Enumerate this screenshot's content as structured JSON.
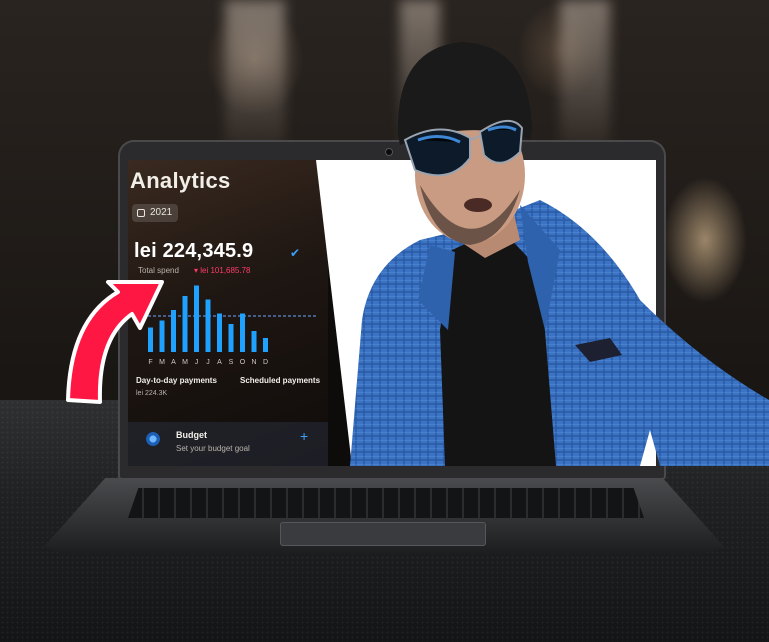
{
  "app": {
    "title": "Analytics",
    "year": "2021",
    "amount": "lei 224,345.9",
    "spend_label": "Total spend",
    "spend_change": "▾ lei 101,685.78",
    "months": [
      "F",
      "M",
      "A",
      "M",
      "J",
      "J",
      "A",
      "S",
      "O",
      "N",
      "D"
    ],
    "bar_levels": [
      0.35,
      0.45,
      0.6,
      0.8,
      0.95,
      0.75,
      0.55,
      0.4,
      0.55,
      0.3,
      0.2
    ],
    "day_payments_label": "Day-to-day payments",
    "day_payments_value": "lei 224.3K",
    "scheduled_label": "Scheduled payments",
    "budget_title": "Budget",
    "budget_sub": "Set your budget goal",
    "colors": {
      "accent": "#3aa0ff",
      "bar": "#1fa2ff",
      "negative": "#ff3b6b"
    }
  },
  "overlay": {
    "arrow_color": "#ff1744",
    "person_jacket": "#3b74c4"
  }
}
